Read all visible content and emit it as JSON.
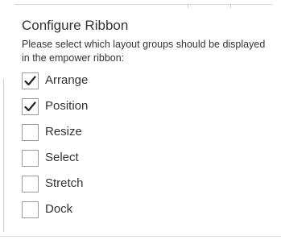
{
  "panel": {
    "title": "Configure Ribbon",
    "description": "Please select which layout groups should be displayed in the empower ribbon:"
  },
  "options": [
    {
      "label": "Arrange",
      "checked": true
    },
    {
      "label": "Position",
      "checked": true
    },
    {
      "label": "Resize",
      "checked": false
    },
    {
      "label": "Select",
      "checked": false
    },
    {
      "label": "Stretch",
      "checked": false
    },
    {
      "label": "Dock",
      "checked": false
    }
  ],
  "icons": {
    "check": "checkmark-icon"
  },
  "colors": {
    "checkbox_border": "#9a9a9a",
    "checkmark": "#222222",
    "text": "#333333"
  }
}
